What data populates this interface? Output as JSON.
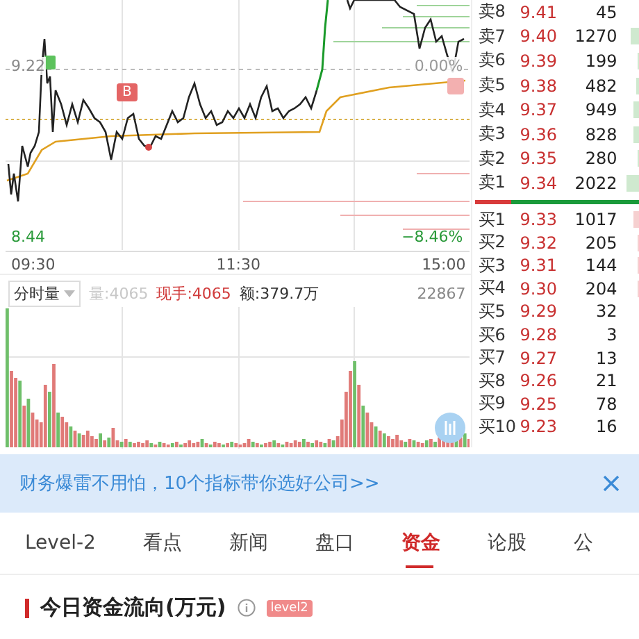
{
  "chart": {
    "price_high": "9.22",
    "pct_mid": "0.00%",
    "price_low": "8.44",
    "pct_low": "−8.46%",
    "marker": "B",
    "times": [
      "09:30",
      "11:30",
      "15:00"
    ]
  },
  "volume": {
    "selector": "分时量",
    "volume_label": "量:4065",
    "current_hand": "现手:4065",
    "amount": "额:379.7万",
    "max": "22867"
  },
  "order_book": {
    "sell": [
      {
        "label": "卖8",
        "price": "9.41",
        "volume": "45"
      },
      {
        "label": "卖7",
        "price": "9.40",
        "volume": "1270"
      },
      {
        "label": "卖6",
        "price": "9.39",
        "volume": "199"
      },
      {
        "label": "卖5",
        "price": "9.38",
        "volume": "482"
      },
      {
        "label": "卖4",
        "price": "9.37",
        "volume": "949"
      },
      {
        "label": "卖3",
        "price": "9.36",
        "volume": "828"
      },
      {
        "label": "卖2",
        "price": "9.35",
        "volume": "280"
      },
      {
        "label": "卖1",
        "price": "9.34",
        "volume": "2022"
      }
    ],
    "buy": [
      {
        "label": "买1",
        "price": "9.33",
        "volume": "1017"
      },
      {
        "label": "买2",
        "price": "9.32",
        "volume": "205"
      },
      {
        "label": "买3",
        "price": "9.31",
        "volume": "144"
      },
      {
        "label": "买4",
        "price": "9.30",
        "volume": "204"
      },
      {
        "label": "买5",
        "price": "9.29",
        "volume": "32"
      },
      {
        "label": "买6",
        "price": "9.28",
        "volume": "3"
      },
      {
        "label": "买7",
        "price": "9.27",
        "volume": "13"
      },
      {
        "label": "买8",
        "price": "9.26",
        "volume": "21"
      },
      {
        "label": "买9",
        "price": "9.25",
        "volume": "78"
      },
      {
        "label": "买10",
        "price": "9.23",
        "volume": "16"
      }
    ]
  },
  "banner": {
    "text": "财务爆雷不用怕，10个指标带你选好公司>>"
  },
  "tabs": [
    {
      "label": "Level-2",
      "selected": false
    },
    {
      "label": "看点",
      "selected": false
    },
    {
      "label": "新闻",
      "selected": false
    },
    {
      "label": "盘口",
      "selected": false
    },
    {
      "label": "资金",
      "selected": true
    },
    {
      "label": "论股",
      "selected": false
    },
    {
      "label": "公",
      "selected": false
    }
  ],
  "section": {
    "title": "今日资金流向(万元)",
    "badge": "level2"
  }
}
